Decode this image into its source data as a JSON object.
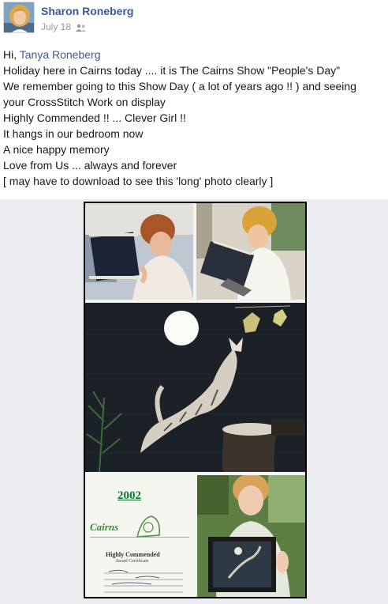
{
  "post": {
    "author": "Sharon Roneberg",
    "date": "July 18",
    "audience_icon": "friends-icon"
  },
  "message": {
    "greeting": "Hi, ",
    "mention": "Tanya Roneberg",
    "lines": [
      "Holiday here in Cairns today .... it is The Cairns Show \"People's Day\"",
      "We remember going to this Show Day ( a lot of years ago !! ) and seeing",
      "your CrossStitch Work on display",
      "Highly Commended !! ... Clever Girl !!",
      "It hangs in our bedroom now",
      "A nice happy memory",
      "Love from Us ... always and forever",
      "[ may have to download to see this 'long' photo clearly ]"
    ]
  },
  "photo": {
    "certificate": {
      "year": "2002",
      "logo": "Cairns",
      "title": "Highly Commended",
      "subtitle": "Award Certificate"
    }
  },
  "colors": {
    "link": "#3b5998",
    "meta": "#9197a3",
    "text": "#141823",
    "photo_bg": "#ebedf0"
  }
}
